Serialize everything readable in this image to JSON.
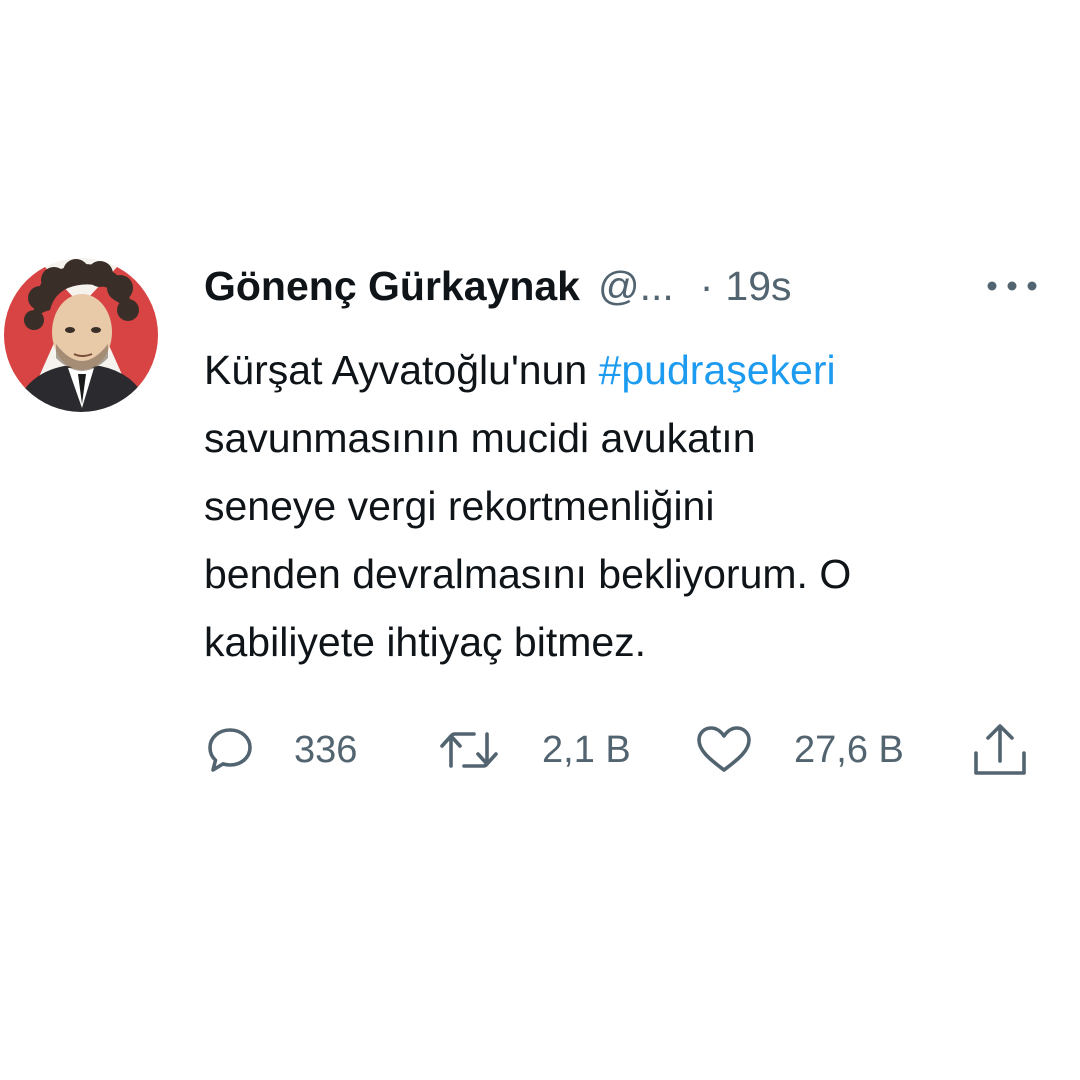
{
  "tweet": {
    "author": {
      "display_name": "Gönenç Gürkaynak",
      "handle": "@...",
      "avatar_icon": "portrait-avatar-icon"
    },
    "separator": "·",
    "time": "19s",
    "more_icon": "more-horizontal-icon",
    "text_lines": [
      {
        "before": "Kürşat Ayvatoğlu'nun ",
        "hashtag": "#pudraşekeri"
      },
      "savunmasının mucidi avukatın",
      "seneye vergi rekortmenliğini",
      "benden devralmasını bekliyorum. O",
      "kabiliyete ihtiyaç bitmez."
    ],
    "actions": {
      "reply": {
        "icon": "reply-icon",
        "count": "336"
      },
      "retweet": {
        "icon": "retweet-icon",
        "count": "2,1 B"
      },
      "like": {
        "icon": "heart-icon",
        "count": "27,6 B"
      },
      "share": {
        "icon": "share-icon"
      }
    }
  },
  "colors": {
    "text": "#0f1419",
    "secondary": "#536471",
    "hashtag": "#1d9bf0",
    "background": "#ffffff"
  }
}
